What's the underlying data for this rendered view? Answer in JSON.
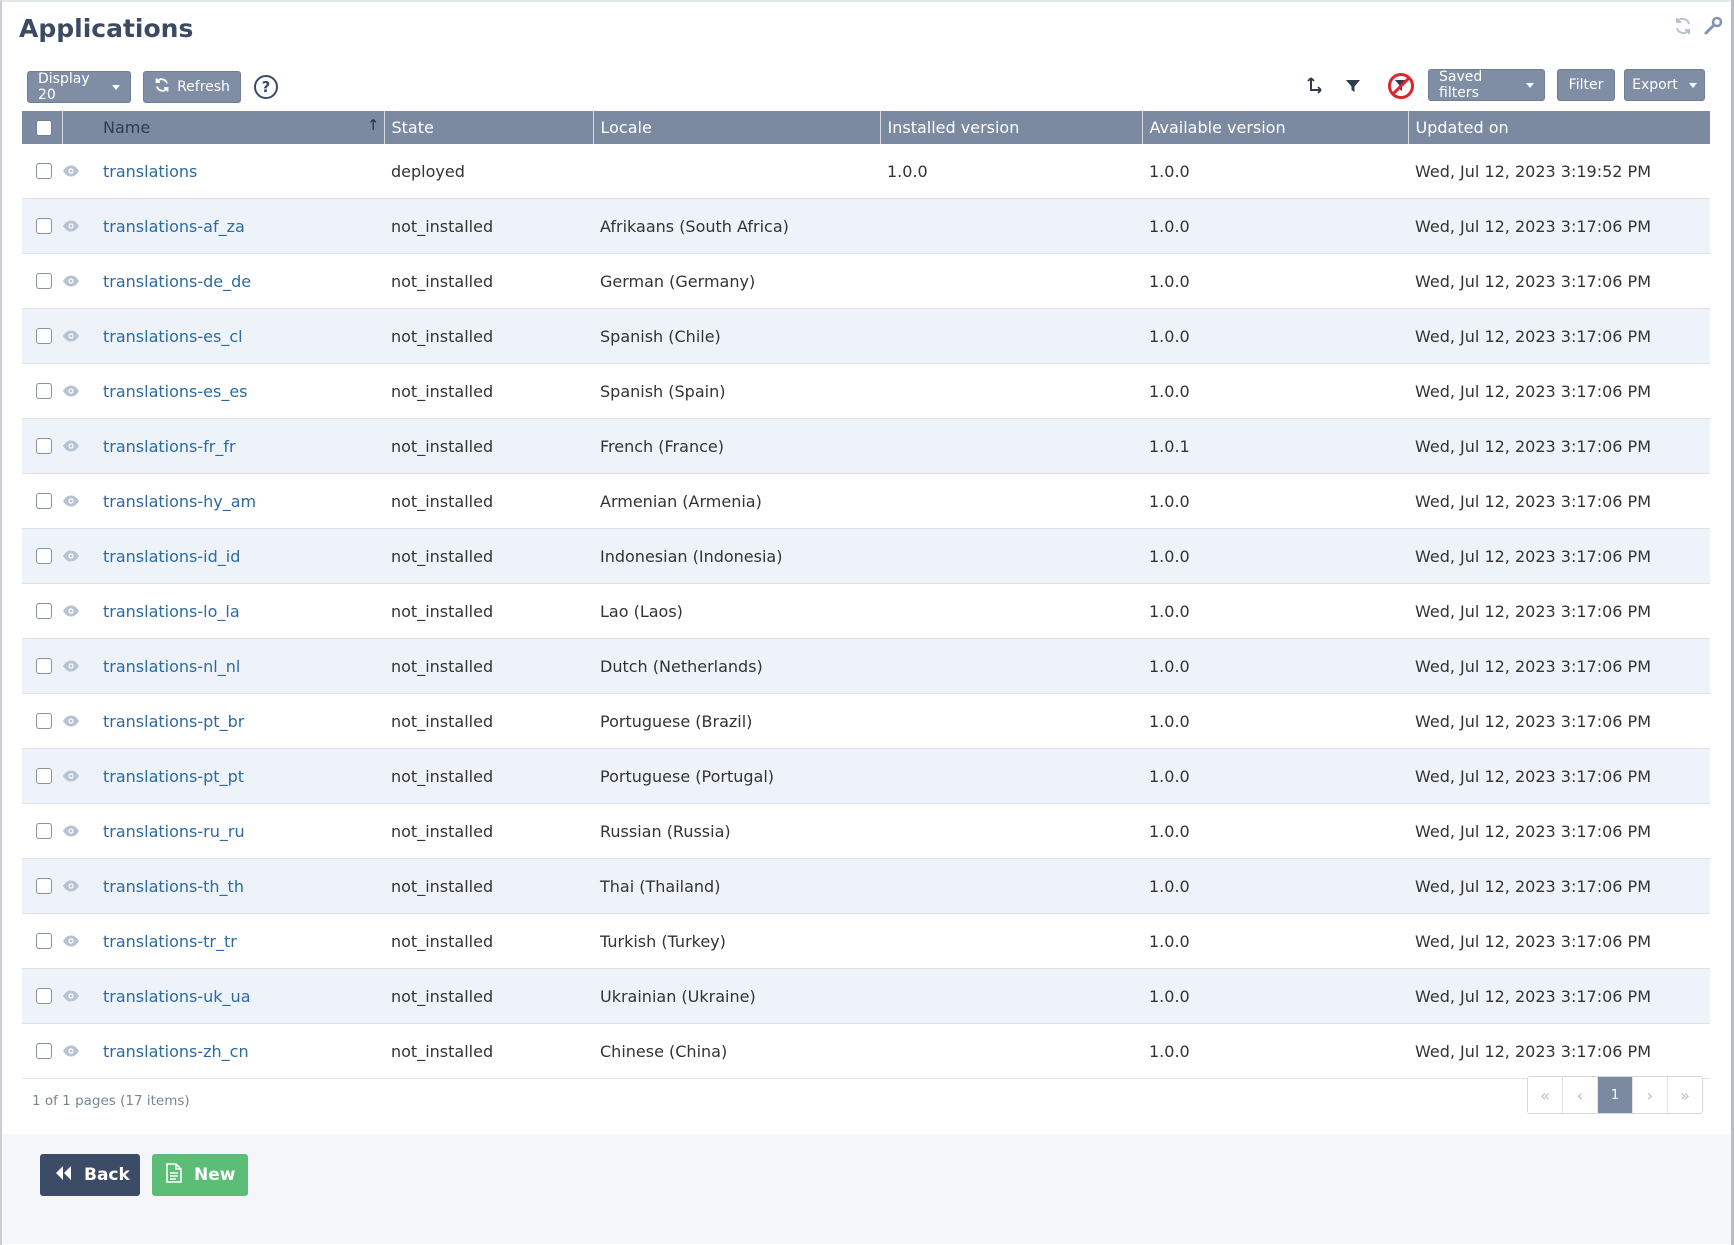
{
  "page": {
    "title": "Applications"
  },
  "toolbar": {
    "display_label": "Display 20",
    "refresh_label": "Refresh",
    "help_label": "?",
    "saved_filters_label": "Saved filters",
    "filter_label": "Filter",
    "export_label": "Export"
  },
  "table": {
    "columns": [
      "Name",
      "State",
      "Locale",
      "Installed version",
      "Available version",
      "Updated on"
    ],
    "rows": [
      {
        "name": "translations",
        "state": "deployed",
        "locale": "",
        "installed": "1.0.0",
        "available": "1.0.0",
        "updated": "Wed, Jul 12, 2023 3:19:52 PM"
      },
      {
        "name": "translations-af_za",
        "state": "not_installed",
        "locale": "Afrikaans (South Africa)",
        "installed": "",
        "available": "1.0.0",
        "updated": "Wed, Jul 12, 2023 3:17:06 PM"
      },
      {
        "name": "translations-de_de",
        "state": "not_installed",
        "locale": "German (Germany)",
        "installed": "",
        "available": "1.0.0",
        "updated": "Wed, Jul 12, 2023 3:17:06 PM"
      },
      {
        "name": "translations-es_cl",
        "state": "not_installed",
        "locale": "Spanish (Chile)",
        "installed": "",
        "available": "1.0.0",
        "updated": "Wed, Jul 12, 2023 3:17:06 PM"
      },
      {
        "name": "translations-es_es",
        "state": "not_installed",
        "locale": "Spanish (Spain)",
        "installed": "",
        "available": "1.0.0",
        "updated": "Wed, Jul 12, 2023 3:17:06 PM"
      },
      {
        "name": "translations-fr_fr",
        "state": "not_installed",
        "locale": "French (France)",
        "installed": "",
        "available": "1.0.1",
        "updated": "Wed, Jul 12, 2023 3:17:06 PM"
      },
      {
        "name": "translations-hy_am",
        "state": "not_installed",
        "locale": "Armenian (Armenia)",
        "installed": "",
        "available": "1.0.0",
        "updated": "Wed, Jul 12, 2023 3:17:06 PM"
      },
      {
        "name": "translations-id_id",
        "state": "not_installed",
        "locale": "Indonesian (Indonesia)",
        "installed": "",
        "available": "1.0.0",
        "updated": "Wed, Jul 12, 2023 3:17:06 PM"
      },
      {
        "name": "translations-lo_la",
        "state": "not_installed",
        "locale": "Lao (Laos)",
        "installed": "",
        "available": "1.0.0",
        "updated": "Wed, Jul 12, 2023 3:17:06 PM"
      },
      {
        "name": "translations-nl_nl",
        "state": "not_installed",
        "locale": "Dutch (Netherlands)",
        "installed": "",
        "available": "1.0.0",
        "updated": "Wed, Jul 12, 2023 3:17:06 PM"
      },
      {
        "name": "translations-pt_br",
        "state": "not_installed",
        "locale": "Portuguese (Brazil)",
        "installed": "",
        "available": "1.0.0",
        "updated": "Wed, Jul 12, 2023 3:17:06 PM"
      },
      {
        "name": "translations-pt_pt",
        "state": "not_installed",
        "locale": "Portuguese (Portugal)",
        "installed": "",
        "available": "1.0.0",
        "updated": "Wed, Jul 12, 2023 3:17:06 PM"
      },
      {
        "name": "translations-ru_ru",
        "state": "not_installed",
        "locale": "Russian (Russia)",
        "installed": "",
        "available": "1.0.0",
        "updated": "Wed, Jul 12, 2023 3:17:06 PM"
      },
      {
        "name": "translations-th_th",
        "state": "not_installed",
        "locale": "Thai (Thailand)",
        "installed": "",
        "available": "1.0.0",
        "updated": "Wed, Jul 12, 2023 3:17:06 PM"
      },
      {
        "name": "translations-tr_tr",
        "state": "not_installed",
        "locale": "Turkish (Turkey)",
        "installed": "",
        "available": "1.0.0",
        "updated": "Wed, Jul 12, 2023 3:17:06 PM"
      },
      {
        "name": "translations-uk_ua",
        "state": "not_installed",
        "locale": "Ukrainian (Ukraine)",
        "installed": "",
        "available": "1.0.0",
        "updated": "Wed, Jul 12, 2023 3:17:06 PM"
      },
      {
        "name": "translations-zh_cn",
        "state": "not_installed",
        "locale": "Chinese (China)",
        "installed": "",
        "available": "1.0.0",
        "updated": "Wed, Jul 12, 2023 3:17:06 PM"
      }
    ]
  },
  "pagination": {
    "summary": "1 of 1 pages (17 items)",
    "first": "«",
    "prev": "‹",
    "current": "1",
    "next": "›",
    "last": "»"
  },
  "actions": {
    "back_label": "Back",
    "new_label": "New"
  },
  "colors": {
    "header_bg": "#7b8aa1",
    "link": "#2b6aa3",
    "title": "#3b4a63",
    "back_button": "#3d4c66",
    "new_button": "#5cbd76",
    "clear_filter_icon": "#e0242b"
  },
  "icons": {
    "refresh": "refresh-icon",
    "help": "help-icon",
    "tree": "hierarchy-icon",
    "filter": "funnel-icon",
    "clear_filter": "no-filter-icon",
    "eye": "eye-icon",
    "back": "double-chevron-left-icon",
    "new": "document-icon",
    "reload": "reload-icon",
    "wrench": "wrench-icon"
  }
}
